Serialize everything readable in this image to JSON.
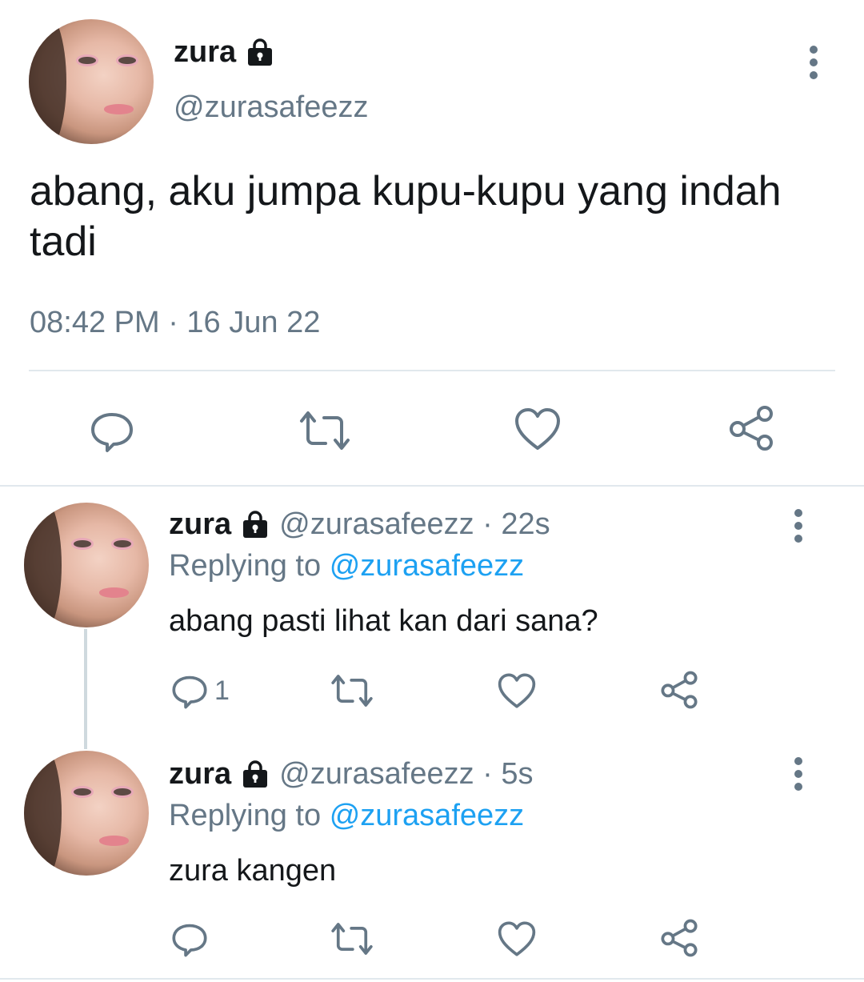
{
  "main_tweet": {
    "display_name": "zura",
    "handle": "@zurasafeezz",
    "text": "abang, aku jumpa kupu-kupu yang indah tadi",
    "timestamp": "08:42 PM · 16 Jun 22",
    "icons": {
      "reply": "reply-icon",
      "retweet": "retweet-icon",
      "like": "like-icon",
      "share": "share-icon",
      "lock": "lock-icon",
      "more": "more-icon"
    }
  },
  "replies": [
    {
      "display_name": "zura",
      "handle_time": "@zurasafeezz · 22s",
      "replying_label": "Replying to",
      "replying_to": "@zurasafeezz",
      "text": "abang pasti lihat kan dari sana?",
      "reply_count": "1"
    },
    {
      "display_name": "zura",
      "handle_time": "@zurasafeezz · 5s",
      "replying_label": "Replying to",
      "replying_to": "@zurasafeezz",
      "text": "zura kangen",
      "reply_count": ""
    }
  ],
  "colors": {
    "text": "#14171a",
    "secondary": "#657786",
    "link": "#1da1f2",
    "divider": "#e1e8ed"
  }
}
